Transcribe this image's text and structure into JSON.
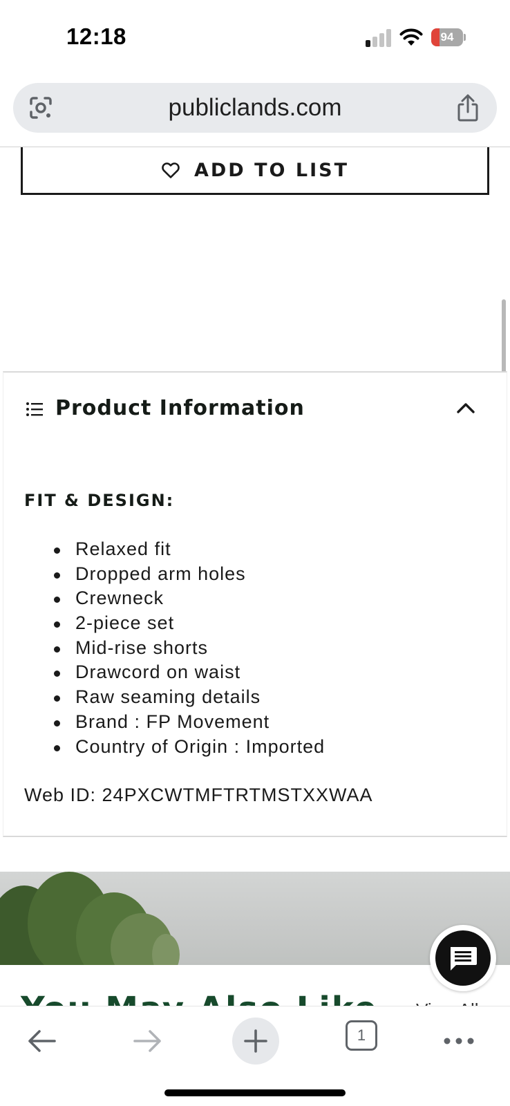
{
  "status_bar": {
    "time": "12:18",
    "battery_percent": "94",
    "battery_color": "#e0443a",
    "signal_bars_active": 1,
    "signal_bars_total": 4,
    "icons": [
      "signal-icon",
      "wifi-icon",
      "battery-icon"
    ]
  },
  "url_bar": {
    "url": "publiclands.com",
    "left_icon": "lens-icon",
    "right_icon": "share-icon"
  },
  "add_to_list": {
    "label": "ADD TO LIST",
    "icon": "heart-icon"
  },
  "product_information": {
    "title": "Product Information",
    "expanded": true,
    "icon": "list-icon",
    "toggle_icon": "chevron-up-icon",
    "section_heading": "FIT & DESIGN:",
    "features": [
      "Relaxed fit",
      "Dropped arm holes",
      "Crewneck",
      "2-piece set",
      "Mid-rise shorts",
      "Drawcord on waist",
      "Raw seaming details",
      "Brand : FP Movement",
      "Country of Origin : Imported"
    ],
    "web_id": "Web ID: 24PXCWTMFTRTMSTXXWAA"
  },
  "recommendations": {
    "title": "You May Also Like",
    "view_all": "View All",
    "accent_color": "#174a2c"
  },
  "chat": {
    "icon": "chat-icon"
  },
  "browser_toolbar": {
    "back_icon": "back-arrow-icon",
    "forward_icon": "forward-arrow-icon",
    "new_tab_icon": "plus-icon",
    "tab_count": "1",
    "menu_icon": "more-icon"
  }
}
